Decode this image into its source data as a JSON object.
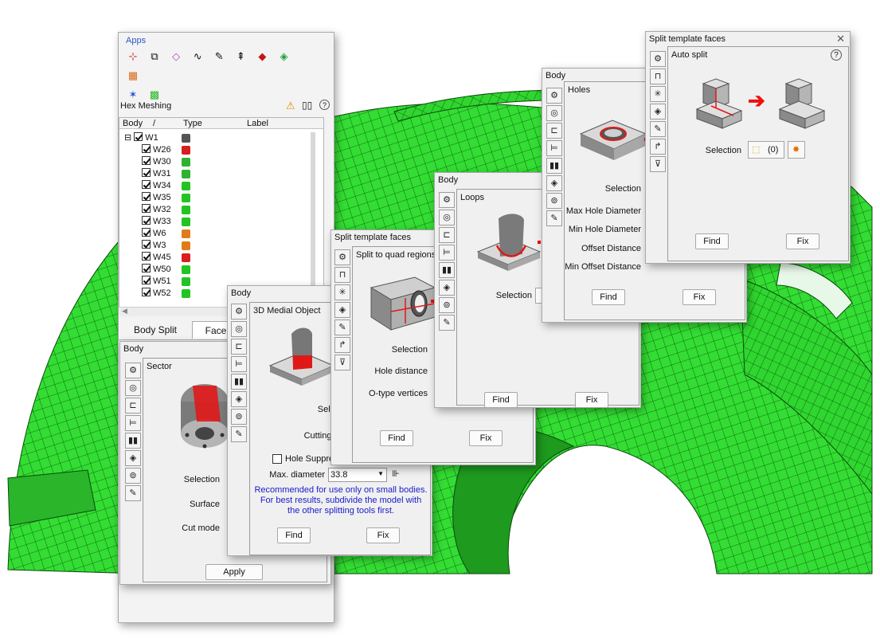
{
  "apps": {
    "title": "Apps",
    "icons": [
      "axis-triad-icon",
      "solid-box-icon",
      "surface-icon",
      "curve-icon",
      "pen-curve-icon",
      "move-icon",
      "cut-surface-icon",
      "flatten-icon",
      "tet-mesh-icon",
      "split-burst-icon",
      "hex-block-icon"
    ]
  },
  "hex_meshing": {
    "title": "Hex Meshing",
    "columns": {
      "body": "Body",
      "sort": "/",
      "type": "Type",
      "label": "Label"
    },
    "expand_symbol": "⊟",
    "rows": [
      {
        "name": "W1",
        "color": "#555555"
      },
      {
        "name": "W26",
        "color": "#d81e1e"
      },
      {
        "name": "W30",
        "color": "#2fb22f"
      },
      {
        "name": "W31",
        "color": "#2fb22f"
      },
      {
        "name": "W34",
        "color": "#22c422"
      },
      {
        "name": "W35",
        "color": "#22c422"
      },
      {
        "name": "W32",
        "color": "#22c422"
      },
      {
        "name": "W33",
        "color": "#22c422"
      },
      {
        "name": "W6",
        "color": "#e07b1a"
      },
      {
        "name": "W3",
        "color": "#e07b1a"
      },
      {
        "name": "W45",
        "color": "#d81e1e"
      },
      {
        "name": "W50",
        "color": "#22c422"
      },
      {
        "name": "W51",
        "color": "#22c422"
      },
      {
        "name": "W52",
        "color": "#22c422"
      }
    ],
    "tabs": {
      "body_split": "Body Split",
      "face": "Face"
    }
  },
  "sector_panel": {
    "header": "Body",
    "title": "Sector",
    "selection_label": "Selection",
    "surface_label": "Surface",
    "cutmode_label": "Cut mode",
    "apply_label": "Apply"
  },
  "medial_panel": {
    "header": "Body",
    "title": "3D Medial Object",
    "selection_label": "Selection",
    "cutting_label": "Cutting edge",
    "hole_label": "Hole Suppre",
    "maxdiam_label": "Max. diameter",
    "maxdiam_value": "33.8",
    "note": "Recommended for use only on small bodies. For best results, subdivide the model with the other splitting tools first.",
    "find": "Find",
    "fix": "Fix"
  },
  "quad_panel": {
    "header": "Split template faces",
    "title": "Split to quad regions",
    "selection_label": "Selection",
    "hole_distance_label": "Hole distance",
    "otype_label": "O-type vertices",
    "find": "Find",
    "fix": "Fix"
  },
  "loops_panel": {
    "header": "Body",
    "title": "Loops",
    "selection_label": "Selection",
    "find": "Find",
    "fix": "Fix"
  },
  "holes_panel": {
    "header": "Body",
    "title": "Holes",
    "selection_label": "Selection",
    "max_hole_label": "Max Hole Diameter",
    "min_hole_label": "Min Hole Diameter",
    "offset_label": "Offset Distance",
    "min_offset_label": "Min Offset Distance",
    "find": "Find",
    "fix": "Fix"
  },
  "auto_panel": {
    "header": "Split template faces",
    "title": "Auto split",
    "selection_label": "Selection",
    "selection_count": "(0)",
    "find": "Find",
    "fix": "Fix"
  },
  "colors": {
    "mesh": "#33dd33",
    "accent_blue": "#2a56c6",
    "note_blue": "#1a1acc",
    "arrow_red": "#ee1111"
  }
}
